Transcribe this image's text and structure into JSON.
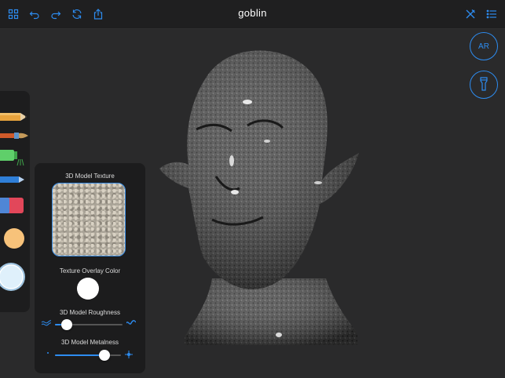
{
  "app": {
    "title": "goblin"
  },
  "toolbar": {
    "left_icons": [
      "grid-icon",
      "undo-icon",
      "redo-icon",
      "refresh-icon",
      "share-icon"
    ],
    "right_icons": [
      "tools-icon",
      "menu-icon"
    ]
  },
  "side_buttons": {
    "ar_label": "AR",
    "light_icon": "flashlight-icon"
  },
  "panel": {
    "texture_label": "3D Model Texture",
    "overlay_label": "Texture Overlay Color",
    "overlay_color": "#ffffff",
    "roughness_label": "3D Model Roughness",
    "roughness_value": 0.18,
    "metalness_label": "3D Model Metalness",
    "metalness_value": 0.75
  },
  "colors": {
    "accent": "#2d8cf0",
    "panel_bg": "#1c1c1d",
    "canvas_bg": "#2a2a2b",
    "current_color": "#f7c27a"
  }
}
